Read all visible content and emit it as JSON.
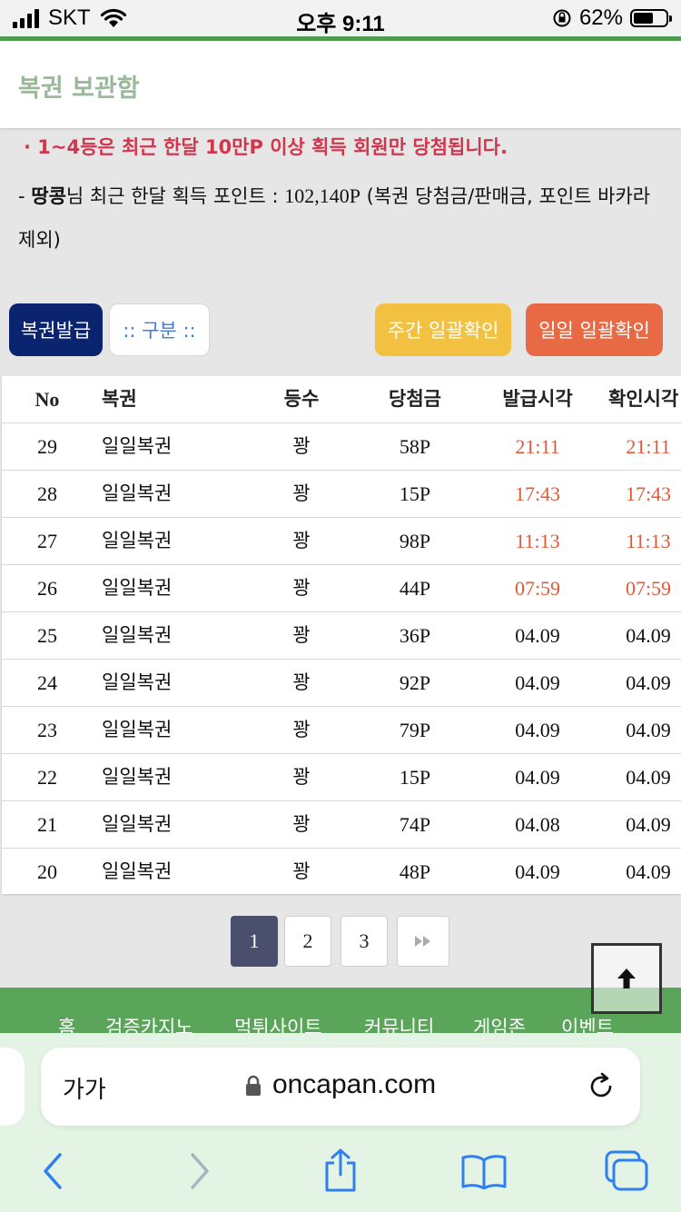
{
  "status_bar": {
    "carrier": "SKT",
    "time": "오후 9:11",
    "battery": "62%",
    "battery_level": 0.62
  },
  "header": {
    "title": "복권 보관함"
  },
  "notice": {
    "line1": "· 1~4등은 최근 한달 10만P 이상 획득 회원만 당첨됩니다.",
    "prefix": "- ",
    "nickname": "땅콩",
    "line2_mid": "님 최근 한달 획득 포인트 : ",
    "points": "102,140P",
    "line2_rest": " (복권 당첨금/판매금, 포인트 바카라 제외)"
  },
  "buttons": {
    "issue": "복권발급",
    "category": ":: 구분 ::",
    "weekly": "주간 일괄확인",
    "daily": "일일 일괄확인"
  },
  "table": {
    "headers": [
      "No",
      "복권",
      "등수",
      "당첨금",
      "발급시각",
      "확인시각"
    ],
    "rows": [
      {
        "no": "29",
        "lotto": "일일복권",
        "rank": "꽝",
        "prize": "58P",
        "issued": "21:11",
        "checked": "21:11",
        "recent": true
      },
      {
        "no": "28",
        "lotto": "일일복권",
        "rank": "꽝",
        "prize": "15P",
        "issued": "17:43",
        "checked": "17:43",
        "recent": true
      },
      {
        "no": "27",
        "lotto": "일일복권",
        "rank": "꽝",
        "prize": "98P",
        "issued": "11:13",
        "checked": "11:13",
        "recent": true
      },
      {
        "no": "26",
        "lotto": "일일복권",
        "rank": "꽝",
        "prize": "44P",
        "issued": "07:59",
        "checked": "07:59",
        "recent": true
      },
      {
        "no": "25",
        "lotto": "일일복권",
        "rank": "꽝",
        "prize": "36P",
        "issued": "04.09",
        "checked": "04.09",
        "recent": false
      },
      {
        "no": "24",
        "lotto": "일일복권",
        "rank": "꽝",
        "prize": "92P",
        "issued": "04.09",
        "checked": "04.09",
        "recent": false
      },
      {
        "no": "23",
        "lotto": "일일복권",
        "rank": "꽝",
        "prize": "79P",
        "issued": "04.09",
        "checked": "04.09",
        "recent": false
      },
      {
        "no": "22",
        "lotto": "일일복권",
        "rank": "꽝",
        "prize": "15P",
        "issued": "04.09",
        "checked": "04.09",
        "recent": false
      },
      {
        "no": "21",
        "lotto": "일일복권",
        "rank": "꽝",
        "prize": "74P",
        "issued": "04.08",
        "checked": "04.09",
        "recent": false
      },
      {
        "no": "20",
        "lotto": "일일복권",
        "rank": "꽝",
        "prize": "48P",
        "issued": "04.09",
        "checked": "04.09",
        "recent": false
      }
    ]
  },
  "pagination": {
    "pages": [
      "1",
      "2",
      "3"
    ],
    "current": "1",
    "next_icon": "fast-forward-icon"
  },
  "footer_nav": [
    "홈",
    "검증카지노",
    "먹튀사이트",
    "커뮤니티",
    "게임존",
    "이벤트"
  ],
  "browser": {
    "text_size": "가가",
    "url": "oncapan.com"
  },
  "colors": {
    "accent_green": "#4e9e4e",
    "notice_red": "#d0364e",
    "recent_time": "#e05a3a",
    "issue_button": "#0a2470",
    "weekly_button": "#f2c141",
    "daily_button": "#e86a45",
    "page_active": "#4a4f6e"
  }
}
